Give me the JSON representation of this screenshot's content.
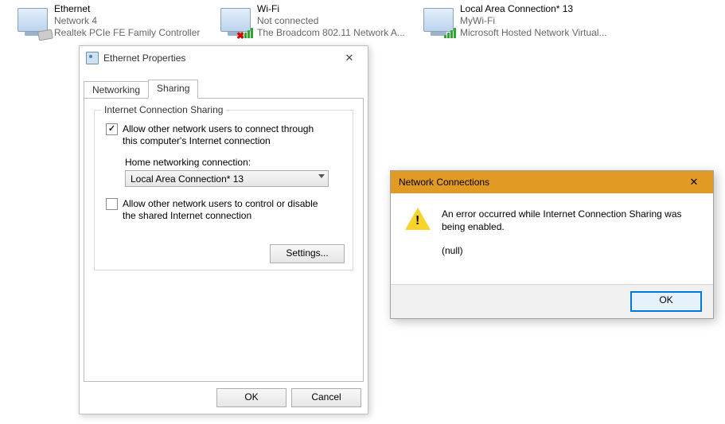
{
  "network_list": [
    {
      "name": "Ethernet",
      "line2": "Network 4",
      "line3": "Realtek PCIe FE Family Controller",
      "kind": "ethernet",
      "error": false
    },
    {
      "name": "Wi-Fi",
      "line2": "Not connected",
      "line3": "The Broadcom 802.11 Network A...",
      "kind": "wifi",
      "error": true
    },
    {
      "name": "Local Area Connection* 13",
      "line2": "MyWi-Fi",
      "line3": "Microsoft Hosted Network Virtual...",
      "kind": "wifi",
      "error": false
    }
  ],
  "props": {
    "title": "Ethernet Properties",
    "tabs": {
      "networking": "Networking",
      "sharing": "Sharing"
    },
    "group_title": "Internet Connection Sharing",
    "allow_connect_label": "Allow other network users to connect through this computer's Internet connection",
    "home_label": "Home networking connection:",
    "home_value": "Local Area Connection* 13",
    "allow_control_label": "Allow other network users to control or disable the shared Internet connection",
    "settings_btn": "Settings...",
    "ok": "OK",
    "cancel": "Cancel"
  },
  "error_dialog": {
    "title": "Network Connections",
    "message": "An error occurred while Internet Connection Sharing was being enabled.",
    "detail": "(null)",
    "ok": "OK"
  }
}
